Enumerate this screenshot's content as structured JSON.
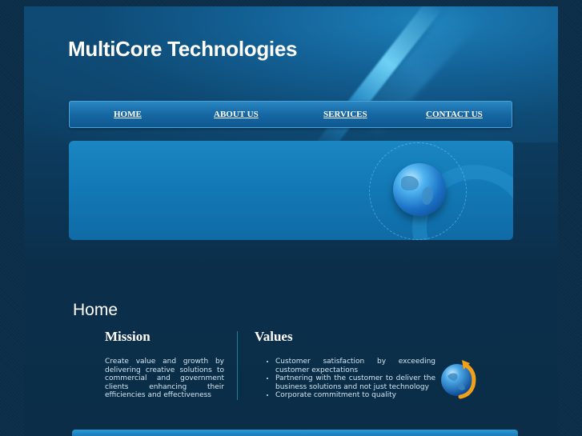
{
  "header": {
    "site_title": "MultiCore Technologies"
  },
  "nav": {
    "items": [
      {
        "label": "HOME"
      },
      {
        "label": "ABOUT US"
      },
      {
        "label": "SERVICES"
      },
      {
        "label": "CONTACT US"
      }
    ]
  },
  "main": {
    "heading": "Home",
    "mission": {
      "title": "Mission",
      "text": "Create value and growth by delivering creative solutions to commercial and government clients enhancing their efficiencies and effectiveness"
    },
    "values": {
      "title": "Values",
      "items": [
        "Customer satisfaction by exceeding customer expectations",
        "Partnering with the customer to deliver the business solutions and not just technology",
        "Corporate commitment to quality"
      ]
    }
  },
  "colors": {
    "background": "#0b2d47",
    "nav_bar": "#1668a3",
    "banner": "#137bb8",
    "text": "#ffffff"
  },
  "icons": [
    "globe-icon",
    "globe-refresh-icon"
  ]
}
